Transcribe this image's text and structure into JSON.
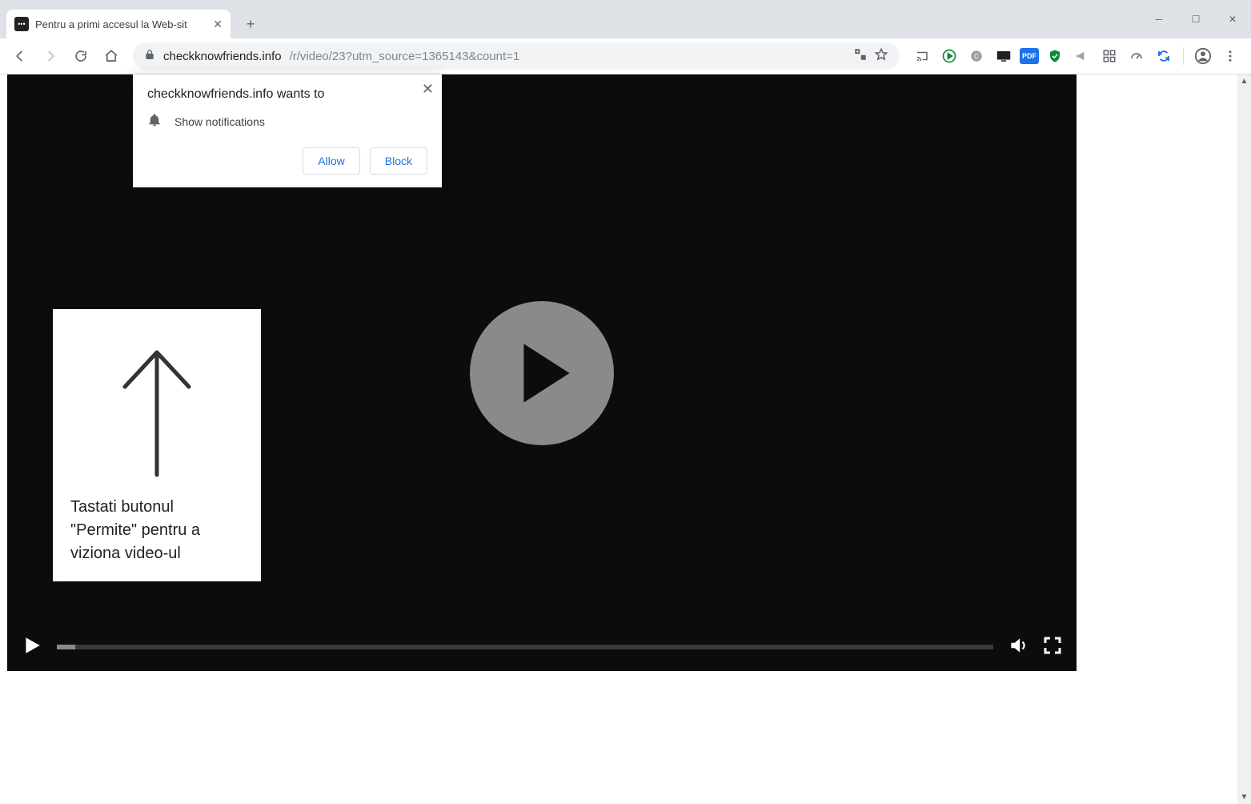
{
  "tab": {
    "title": "Pentru a primi accesul la Web-sit"
  },
  "address": {
    "host": "checkknowfriends.info",
    "path": "/r/video/23?utm_source=1365143&count=1"
  },
  "notification": {
    "origin_line": "checkknowfriends.info wants to",
    "permission_label": "Show notifications",
    "allow_label": "Allow",
    "block_label": "Block"
  },
  "instruction": {
    "text": "Tastati butonul \"Permite\" pentru a viziona video-ul"
  },
  "video": {
    "progress_percent": 2
  }
}
